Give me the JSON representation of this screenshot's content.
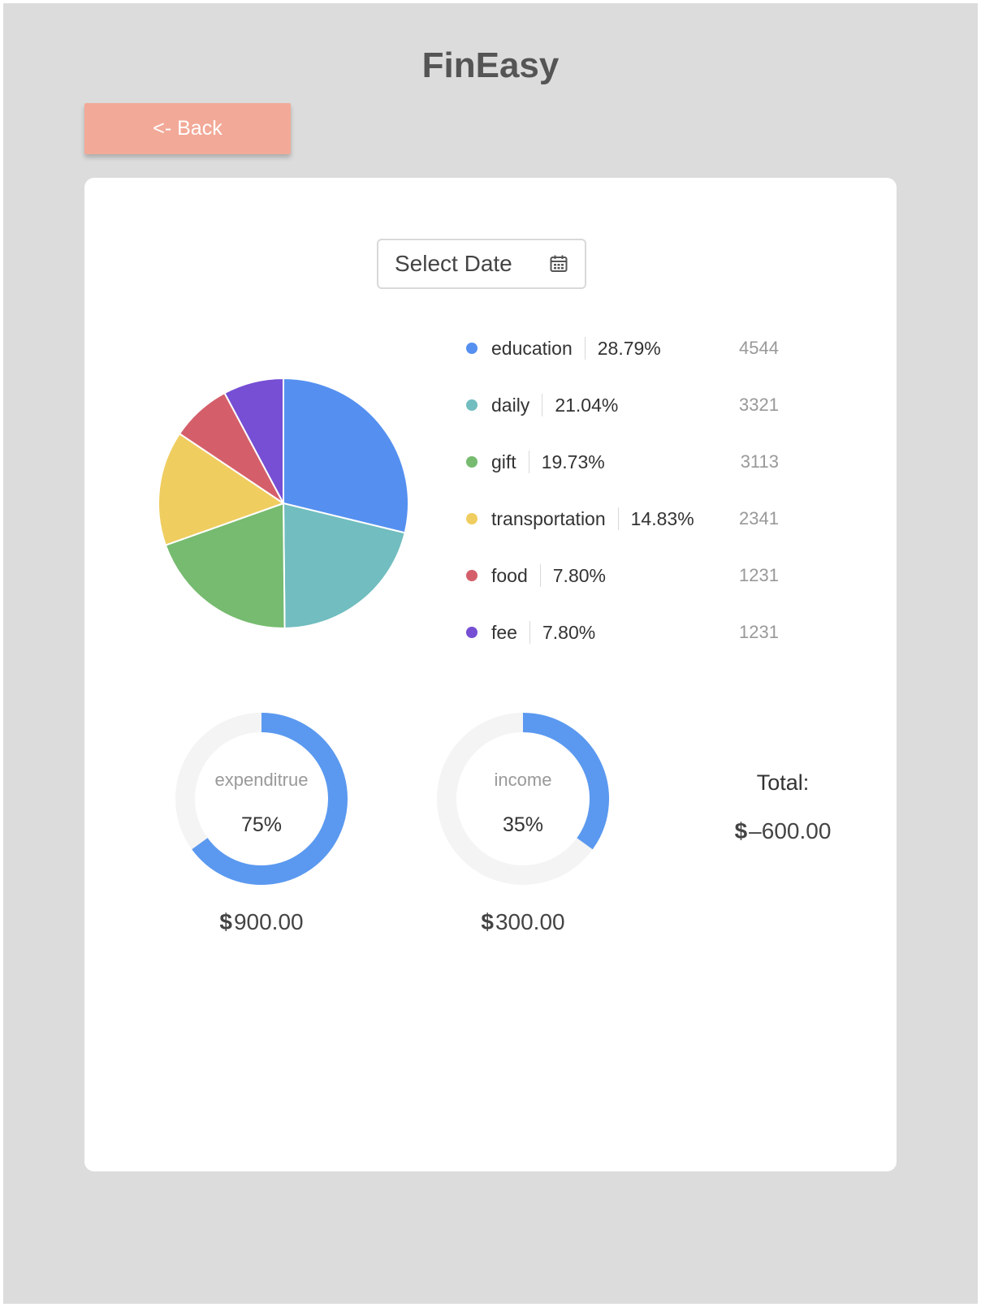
{
  "app": {
    "title": "FinEasy"
  },
  "nav": {
    "back_label": "<- Back"
  },
  "date_picker": {
    "label": "Select Date",
    "icon": "calendar-icon"
  },
  "chart_data": {
    "type": "pie",
    "slices": [
      {
        "name": "education",
        "percent": "28.79%",
        "value": 4544,
        "color": "#5590f0"
      },
      {
        "name": "daily",
        "percent": "21.04%",
        "value": 3321,
        "color": "#71bdbf"
      },
      {
        "name": "gift",
        "percent": "19.73%",
        "value": 3113,
        "color": "#76bb6f"
      },
      {
        "name": "transportation",
        "percent": "14.83%",
        "value": 2341,
        "color": "#efcd5f"
      },
      {
        "name": "food",
        "percent": "7.80%",
        "value": 1231,
        "color": "#d45f6a"
      },
      {
        "name": "fee",
        "percent": "7.80%",
        "value": 1231,
        "color": "#764fd4"
      }
    ]
  },
  "donuts": [
    {
      "caption": "expenditrue",
      "percent_label": "75%",
      "fraction": 0.65,
      "currency": "$",
      "amount": "900.00",
      "color": "#5b99f0",
      "track": "#f4f4f4"
    },
    {
      "caption": "income",
      "percent_label": "35%",
      "fraction": 0.35,
      "currency": "$",
      "amount": "300.00",
      "color": "#5b99f0",
      "track": "#f4f4f4"
    }
  ],
  "total": {
    "label": "Total:",
    "currency": "$",
    "amount": "–600.00"
  }
}
